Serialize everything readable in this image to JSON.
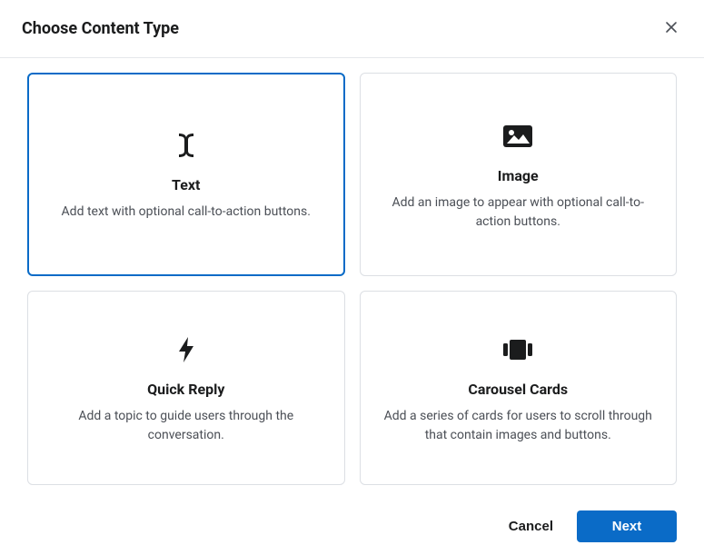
{
  "header": {
    "title": "Choose Content Type"
  },
  "options": {
    "text": {
      "title": "Text",
      "description": "Add text with optional call-to-action buttons.",
      "selected": true
    },
    "image": {
      "title": "Image",
      "description": "Add an image to appear with optional call-to-action buttons."
    },
    "quick_reply": {
      "title": "Quick Reply",
      "description": "Add a topic to guide users through the conversation."
    },
    "carousel": {
      "title": "Carousel Cards",
      "description": "Add a series of cards for users to scroll through that contain images and buttons."
    }
  },
  "footer": {
    "cancel_label": "Cancel",
    "next_label": "Next"
  },
  "colors": {
    "accent": "#0a6bc7"
  }
}
